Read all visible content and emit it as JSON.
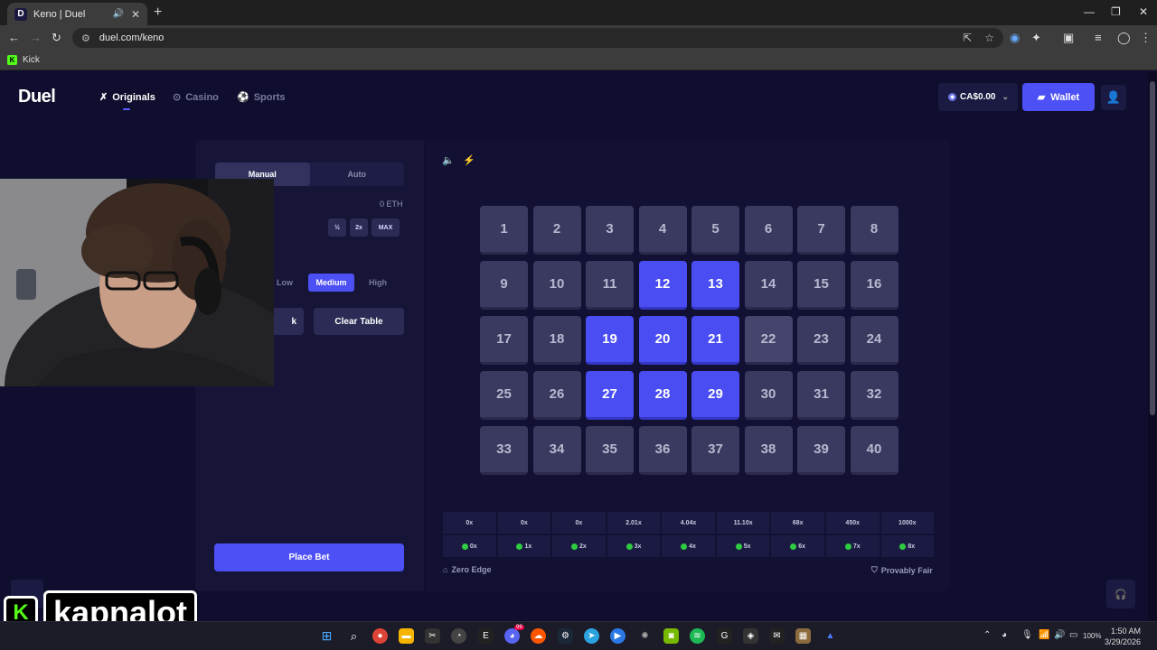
{
  "browser": {
    "tab_title": "Keno | Duel",
    "tab_favicon": "D",
    "url": "duel.com/keno",
    "bookmark": "Kick"
  },
  "header": {
    "logo": "Duel",
    "nav": [
      {
        "label": "Originals",
        "icon": "originals-icon"
      },
      {
        "label": "Casino",
        "icon": "casino-icon"
      },
      {
        "label": "Sports",
        "icon": "sports-icon"
      }
    ],
    "balance": "CA$0.00",
    "wallet_label": "Wallet"
  },
  "panel": {
    "modes": [
      "Manual",
      "Auto"
    ],
    "active_mode": "Manual",
    "bet_currency_value": "0 ETH",
    "amount_buttons": [
      "½",
      "2x",
      "MAX"
    ],
    "risk_levels": [
      "Low",
      "Medium",
      "High"
    ],
    "active_risk": "Medium",
    "autopick_label": "k",
    "clear_label": "Clear Table",
    "place_bet_label": "Place Bet"
  },
  "board": {
    "numbers": [
      1,
      2,
      3,
      4,
      5,
      6,
      7,
      8,
      9,
      10,
      11,
      12,
      13,
      14,
      15,
      16,
      17,
      18,
      19,
      20,
      21,
      22,
      23,
      24,
      25,
      26,
      27,
      28,
      29,
      30,
      31,
      32,
      33,
      34,
      35,
      36,
      37,
      38,
      39,
      40
    ],
    "selected": [
      12,
      13,
      19,
      20,
      21,
      27,
      28,
      29
    ],
    "hovered": 22
  },
  "paytable": {
    "multipliers": [
      "0x",
      "0x",
      "0x",
      "2.01x",
      "4.04x",
      "11.10x",
      "68x",
      "450x",
      "1000x"
    ],
    "hits": [
      "0x",
      "1x",
      "2x",
      "3x",
      "4x",
      "5x",
      "6x",
      "7x",
      "8x"
    ]
  },
  "footer": {
    "zero_edge": "Zero Edge",
    "provably_fair": "Provably Fair"
  },
  "overlay": {
    "streamer": "kapnalot",
    "kick_glyph": "K"
  },
  "taskbar": {
    "time": "1:50 AM",
    "date": "3/29/2026",
    "battery": "100%",
    "badge": "99"
  },
  "colors": {
    "accent": "#4d50f4",
    "page_bg": "#0f0e2e",
    "tile": "#3a3960",
    "kick_green": "#53fc18"
  }
}
